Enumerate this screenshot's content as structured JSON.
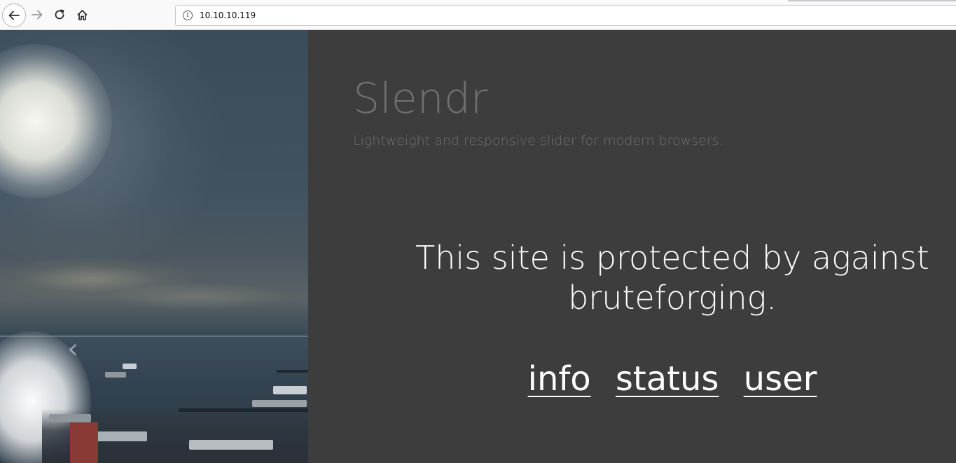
{
  "browser": {
    "url": "10.10.10.119",
    "icons": [
      "back-arrow-icon",
      "forward-arrow-icon",
      "reload-icon",
      "home-icon",
      "info-icon"
    ]
  },
  "slider": {
    "prev_glyph": "‹"
  },
  "page": {
    "brand": "Slendr",
    "tagline": "Lightweight and responsive slider for modern browsers.",
    "notice": "This site is protected by against bruteforging.",
    "links": [
      {
        "label": "info"
      },
      {
        "label": "status"
      },
      {
        "label": "user"
      }
    ]
  },
  "colors": {
    "background": "#3d3d3d",
    "muted_text": "#6f6f6f",
    "text": "#ffffff"
  }
}
